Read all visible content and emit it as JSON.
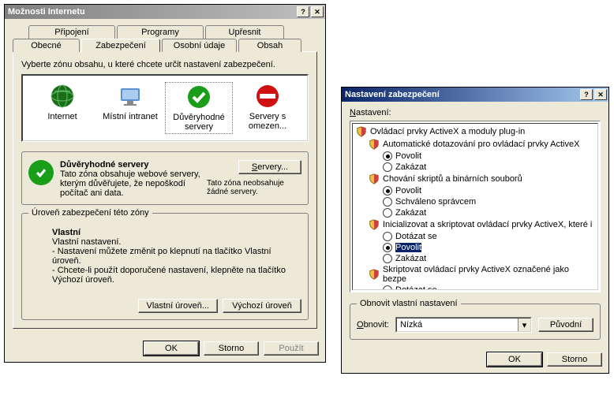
{
  "dialog1": {
    "title": "Možnosti Internetu",
    "help_glyph": "?",
    "close_glyph": "✕",
    "tabs_row1": [
      "Připojení",
      "Programy",
      "Upřesnit"
    ],
    "tabs_row2": [
      "Obecné",
      "Zabezpečení",
      "Osobní údaje",
      "Obsah"
    ],
    "zone_prompt": "Vyberte zónu obsahu, u které chcete určit nastavení zabezpečení.",
    "zones": [
      {
        "label": "Internet"
      },
      {
        "label": "Místní intranet"
      },
      {
        "label": "Důvěryhodné servery"
      },
      {
        "label": "Servery s omezen..."
      }
    ],
    "trusted_title": "Důvěryhodné servery",
    "trusted_desc": "Tato zóna obsahuje webové servery, kterým důvěřujete, že nepoškodí počítač ani data.",
    "servers_btn": "Servery...",
    "no_servers": "Tato zóna neobsahuje žádné servery.",
    "level_group": "Úroveň zabezpečení této zóny",
    "custom_title": "Vlastní",
    "custom_line1": "Vlastní nastavení.",
    "custom_line2": "- Nastavení můžete změnit po klepnutí na tlačítko Vlastní úroveň.",
    "custom_line3": "- Chcete-li použít doporučené nastavení, klepněte na tlačítko Výchozí úroveň.",
    "custom_level_btn": "Vlastní úroveň...",
    "default_level_btn": "Výchozí úroveň",
    "ok_btn": "OK",
    "cancel_btn": "Storno",
    "apply_btn": "Použít"
  },
  "dialog2": {
    "title": "Nastavení zabezpečení",
    "help_glyph": "?",
    "close_glyph": "✕",
    "settings_label": "Nastavení:",
    "tree": [
      {
        "level": 0,
        "kind": "shield",
        "text": "Ovládací prvky ActiveX a moduly plug-in"
      },
      {
        "level": 1,
        "kind": "shield",
        "text": "Automatické dotazování pro ovládací prvky ActiveX"
      },
      {
        "level": 2,
        "kind": "radio",
        "checked": true,
        "text": "Povolit"
      },
      {
        "level": 2,
        "kind": "radio",
        "checked": false,
        "text": "Zakázat"
      },
      {
        "level": 1,
        "kind": "shield",
        "text": "Chování skriptů a binárních souborů"
      },
      {
        "level": 2,
        "kind": "radio",
        "checked": true,
        "text": "Povolit"
      },
      {
        "level": 2,
        "kind": "radio",
        "checked": false,
        "text": "Schváleno správcem"
      },
      {
        "level": 2,
        "kind": "radio",
        "checked": false,
        "text": "Zakázat"
      },
      {
        "level": 1,
        "kind": "shield",
        "text": "Inicializovat a skriptovat ovládací prvky ActiveX, které i"
      },
      {
        "level": 2,
        "kind": "radio",
        "checked": false,
        "text": "Dotázat se"
      },
      {
        "level": 2,
        "kind": "radio",
        "checked": true,
        "text": "Povolit",
        "selected": true
      },
      {
        "level": 2,
        "kind": "radio",
        "checked": false,
        "text": "Zakázat"
      },
      {
        "level": 1,
        "kind": "shield",
        "text": "Skriptovat ovládací prvky ActiveX označené jako bezpe"
      },
      {
        "level": 2,
        "kind": "radio",
        "checked": false,
        "text": "Dotázat se"
      }
    ],
    "reset_group": "Obnovit vlastní nastavení",
    "reset_label": "Obnovit:",
    "reset_value": "Nízká",
    "original_btn": "Původní",
    "ok_btn": "OK",
    "cancel_btn": "Storno"
  }
}
